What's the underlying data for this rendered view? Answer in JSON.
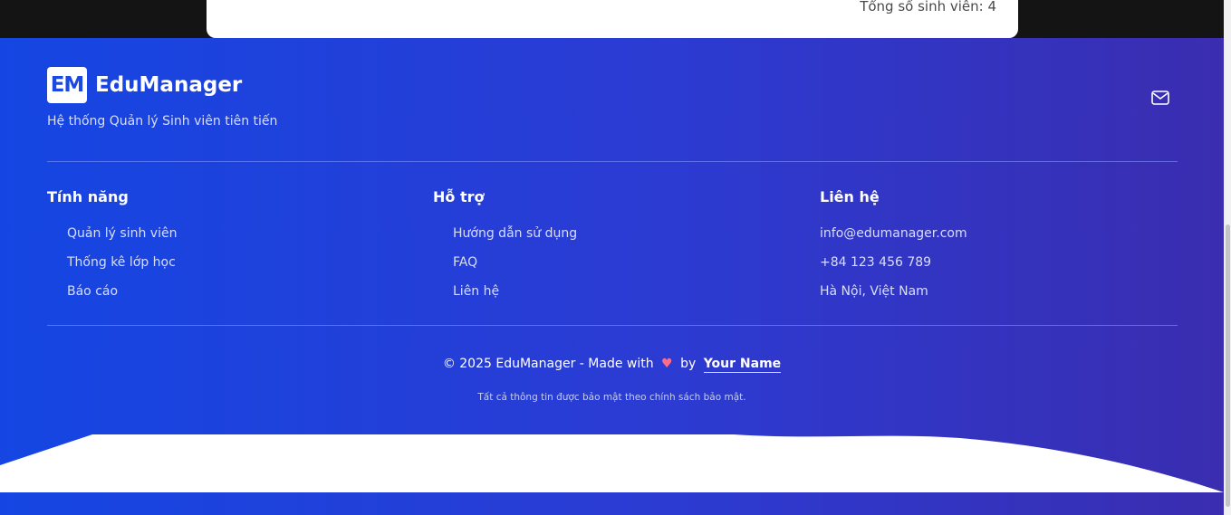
{
  "top_card": {
    "total_students": "Tổng số sinh viên: 4"
  },
  "footer": {
    "brand": {
      "logo": "EM",
      "name": "EduManager",
      "tagline": "Hệ thống Quản lý Sinh viên tiên tiến"
    },
    "mail_icon": "mail-icon",
    "columns": [
      {
        "title": "Tính năng",
        "links": [
          "Quản lý sinh viên",
          "Thống kê lớp học",
          "Báo cáo"
        ]
      },
      {
        "title": "Hỗ trợ",
        "links": [
          "Hướng dẫn sử dụng",
          "FAQ",
          "Liên hệ"
        ]
      },
      {
        "title": "Liên hệ",
        "items": [
          "info@edumanager.com",
          "+84 123 456 789",
          "Hà Nội, Việt Nam"
        ]
      }
    ],
    "copyright": {
      "prefix": "© 2025 EduManager - Made with",
      "by": "by",
      "author": "Your Name"
    },
    "privacy": "Tất cả thông tin được bảo mật theo chính sách bảo mật."
  },
  "colors": {
    "gradient_start": "#1546e3",
    "gradient_end": "#3a2db0",
    "heart": "#ff6b8a",
    "top_background": "#141414"
  }
}
